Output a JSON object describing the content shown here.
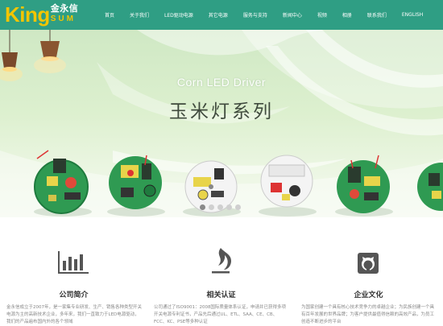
{
  "brand": {
    "mark": "King",
    "chinese_name": "金永信",
    "sub_mark": "SUM",
    "mark_color": "#f2c500"
  },
  "header": {
    "background": "#2f9e84"
  },
  "nav": {
    "items": [
      "首页",
      "关于我们",
      "LED驱动电源",
      "其它电源",
      "服务与支持",
      "新闻中心",
      "视频",
      "相册",
      "联系我们",
      "ENGLISH"
    ]
  },
  "banner": {
    "title_en": "Corn LED Driver",
    "title_cn": "玉米灯系列",
    "products": [
      "round-pcb-driver",
      "round-pcb-driver",
      "round-pcb-driver",
      "round-pcb-driver",
      "round-pcb-driver",
      "round-pcb-driver"
    ],
    "slides": 5,
    "active_slide": 1
  },
  "features": [
    {
      "icon": "bar-chart-icon",
      "title": "公司简介",
      "text": "金永信成立于2007年，是一家集专业研发、生产、销售各种类型开关电源为主的高新技术企业，多年来，我们一直致力于LED电源驱动，我们的产品遍布国内外的各个领域"
    },
    {
      "icon": "flame-icon",
      "title": "相关认证",
      "text": "公司通过了ISO9001：2008国际质量体系认证，申请并已获得多项开关电源专利证书，产品先后通过UL、ETL、SAA、CE、CB、FCC、KC、PSE等多种认证"
    },
    {
      "icon": "github-icon",
      "title": "企业文化",
      "text": "为国家创建一个具有核心技术竞争力的卓越企业；为民族创建一个具有百年发展的世界品牌；为客户提供最值得信赖的高效产品，为员工创造不断进步的平台"
    }
  ]
}
